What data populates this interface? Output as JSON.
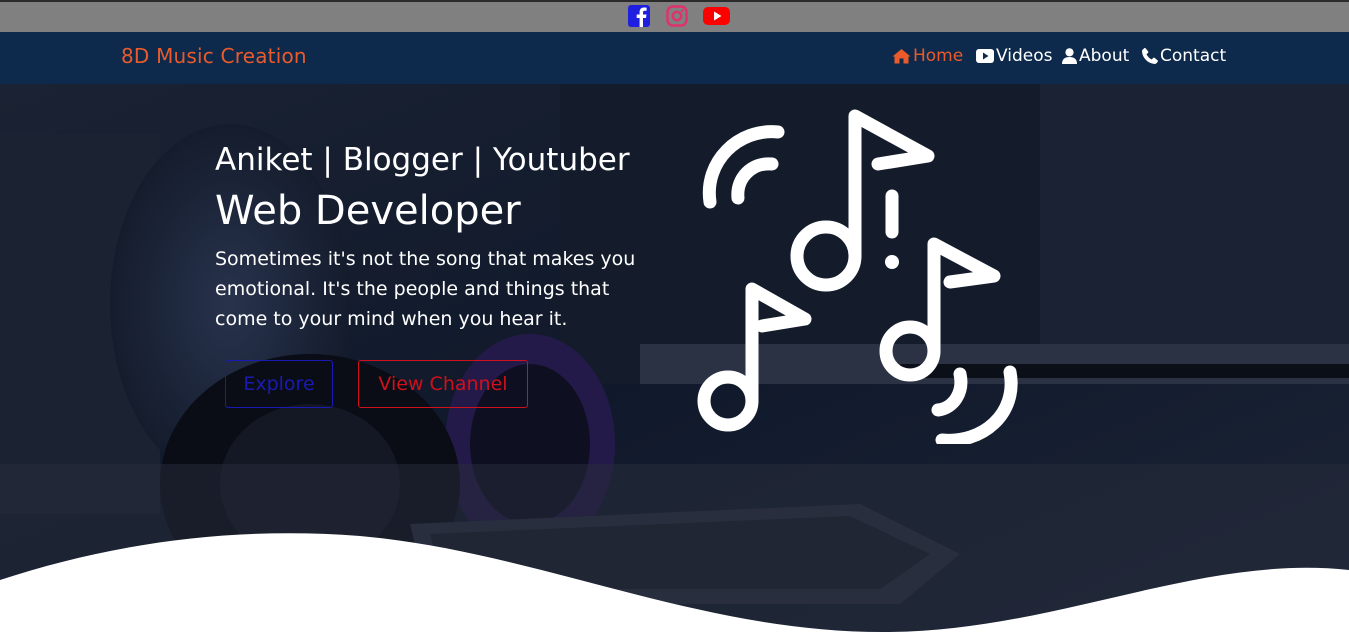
{
  "social": {
    "icons": [
      "facebook-icon",
      "instagram-icon",
      "youtube-icon"
    ],
    "colors": {
      "facebook": "#1f1fe0",
      "instagram": "#e1306c",
      "youtube": "#ff0000"
    }
  },
  "navbar": {
    "brand": "8D Music Creation",
    "items": [
      {
        "label": "Home",
        "icon": "home-icon",
        "active": true
      },
      {
        "label": "Videos",
        "icon": "video-icon",
        "active": false
      },
      {
        "label": "About",
        "icon": "user-icon",
        "active": false
      },
      {
        "label": "Contact",
        "icon": "phone-icon",
        "active": false
      }
    ],
    "background": "#0d2a4c",
    "accent": "#ea5a2a"
  },
  "hero": {
    "subtitle": "Aniket | Blogger | Youtuber",
    "title": "Web Developer",
    "description": "Sometimes it's not the song that makes you emotional. It's the people and things that come to your mind when you hear it.",
    "buttons": {
      "explore": "Explore",
      "view_channel": "View Channel"
    },
    "illustration": "music-notes-icon"
  }
}
